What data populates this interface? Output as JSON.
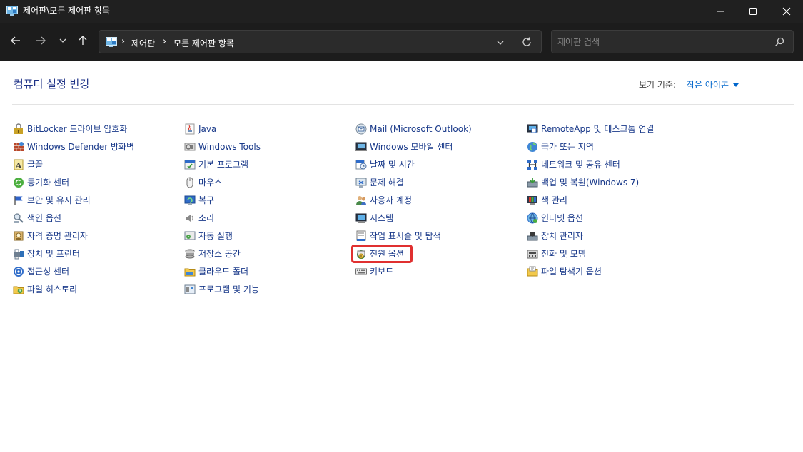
{
  "window": {
    "title": "제어판\\모든 제어판 항목"
  },
  "address": {
    "breadcrumbs": [
      "제어판",
      "모든 제어판 항목"
    ]
  },
  "search": {
    "placeholder": "제어판 검색"
  },
  "header": {
    "title": "컴퓨터 설정 변경",
    "view_by_label": "보기 기준:",
    "view_by_value": "작은 아이콘"
  },
  "columns": [
    {
      "items": [
        {
          "label": "BitLocker 드라이브 암호화",
          "icon": "bitlocker-icon"
        },
        {
          "label": "Windows Defender 방화벽",
          "icon": "firewall-icon"
        },
        {
          "label": "글꼴",
          "icon": "fonts-icon"
        },
        {
          "label": "동기화 센터",
          "icon": "sync-center-icon"
        },
        {
          "label": "보안 및 유지 관리",
          "icon": "security-flag-icon"
        },
        {
          "label": "색인 옵션",
          "icon": "indexing-icon"
        },
        {
          "label": "자격 증명 관리자",
          "icon": "credential-manager-icon"
        },
        {
          "label": "장치 및 프린터",
          "icon": "devices-printers-icon"
        },
        {
          "label": "접근성 센터",
          "icon": "accessibility-icon"
        },
        {
          "label": "파일 히스토리",
          "icon": "file-history-icon"
        }
      ]
    },
    {
      "items": [
        {
          "label": "Java",
          "icon": "java-icon"
        },
        {
          "label": "Windows Tools",
          "icon": "windows-tools-icon"
        },
        {
          "label": "기본 프로그램",
          "icon": "default-programs-icon"
        },
        {
          "label": "마우스",
          "icon": "mouse-icon"
        },
        {
          "label": "복구",
          "icon": "recovery-icon"
        },
        {
          "label": "소리",
          "icon": "sound-icon"
        },
        {
          "label": "자동 실행",
          "icon": "autoplay-icon"
        },
        {
          "label": "저장소 공간",
          "icon": "storage-spaces-icon"
        },
        {
          "label": "클라우드 폴더",
          "icon": "cloud-folder-icon"
        },
        {
          "label": "프로그램 및 기능",
          "icon": "programs-features-icon"
        }
      ]
    },
    {
      "items": [
        {
          "label": "Mail (Microsoft Outlook)",
          "icon": "mail-icon"
        },
        {
          "label": "Windows 모바일 센터",
          "icon": "mobility-center-icon"
        },
        {
          "label": "날짜 및 시간",
          "icon": "date-time-icon"
        },
        {
          "label": "문제 해결",
          "icon": "troubleshooting-icon"
        },
        {
          "label": "사용자 계정",
          "icon": "user-accounts-icon"
        },
        {
          "label": "시스템",
          "icon": "system-icon"
        },
        {
          "label": "작업 표시줄 및 탐색",
          "icon": "taskbar-icon"
        },
        {
          "label": "전원 옵션",
          "icon": "power-options-icon",
          "highlighted": true
        },
        {
          "label": "키보드",
          "icon": "keyboard-icon"
        }
      ]
    },
    {
      "items": [
        {
          "label": "RemoteApp 및 데스크톱 연결",
          "icon": "remoteapp-icon"
        },
        {
          "label": "국가 또는 지역",
          "icon": "region-globe-icon"
        },
        {
          "label": "네트워크 및 공유 센터",
          "icon": "network-icon"
        },
        {
          "label": "백업 및 복원(Windows 7)",
          "icon": "backup-icon"
        },
        {
          "label": "색 관리",
          "icon": "color-management-icon"
        },
        {
          "label": "인터넷 옵션",
          "icon": "internet-options-icon"
        },
        {
          "label": "장치 관리자",
          "icon": "device-manager-icon"
        },
        {
          "label": "전화 및 모뎀",
          "icon": "phone-modem-icon"
        },
        {
          "label": "파일 탐색기 옵션",
          "icon": "file-explorer-options-icon"
        }
      ]
    }
  ]
}
